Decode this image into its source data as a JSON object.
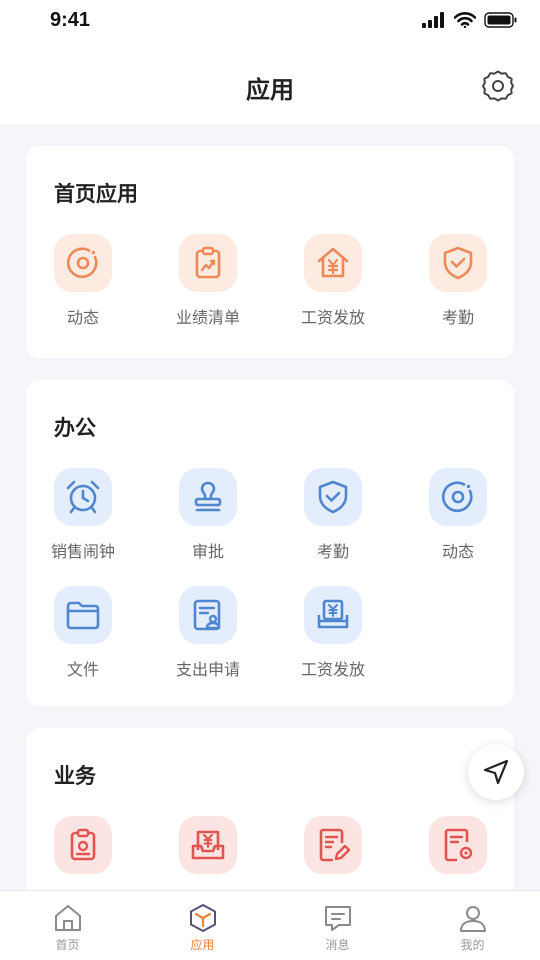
{
  "status_bar": {
    "time": "9:41"
  },
  "header": {
    "title": "应用"
  },
  "sections": [
    {
      "title": "首页应用",
      "apps": [
        {
          "label": "动态",
          "icon": "dynamic-icon"
        },
        {
          "label": "业绩清单",
          "icon": "performance-list-icon"
        },
        {
          "label": "工资发放",
          "icon": "salary-house-icon"
        },
        {
          "label": "考勤",
          "icon": "attendance-shield-icon"
        }
      ]
    },
    {
      "title": "办公",
      "apps": [
        {
          "label": "销售闹钟",
          "icon": "alarm-clock-icon"
        },
        {
          "label": "审批",
          "icon": "stamp-icon"
        },
        {
          "label": "考勤",
          "icon": "attendance-shield-icon"
        },
        {
          "label": "动态",
          "icon": "dynamic-icon"
        },
        {
          "label": "文件",
          "icon": "folder-icon"
        },
        {
          "label": "支出申请",
          "icon": "expense-form-icon"
        },
        {
          "label": "工资发放",
          "icon": "salary-register-icon"
        }
      ]
    },
    {
      "title": "业务",
      "apps": [
        {
          "label": "",
          "icon": "clipboard-icon"
        },
        {
          "label": "",
          "icon": "business-income-icon"
        },
        {
          "label": "",
          "icon": "edit-document-icon"
        },
        {
          "label": "",
          "icon": "settings-document-icon"
        }
      ]
    }
  ],
  "tabs": [
    {
      "label": "首页",
      "icon": "home-icon",
      "active": false
    },
    {
      "label": "应用",
      "icon": "apps-cube-icon",
      "active": true
    },
    {
      "label": "消息",
      "icon": "message-icon",
      "active": false
    },
    {
      "label": "我的",
      "icon": "user-icon",
      "active": false
    }
  ],
  "colors": {
    "accent": "#e8833a",
    "orange_icon": "#ec8a57",
    "blue_icon": "#4f86d0",
    "red_icon": "#e05550"
  }
}
